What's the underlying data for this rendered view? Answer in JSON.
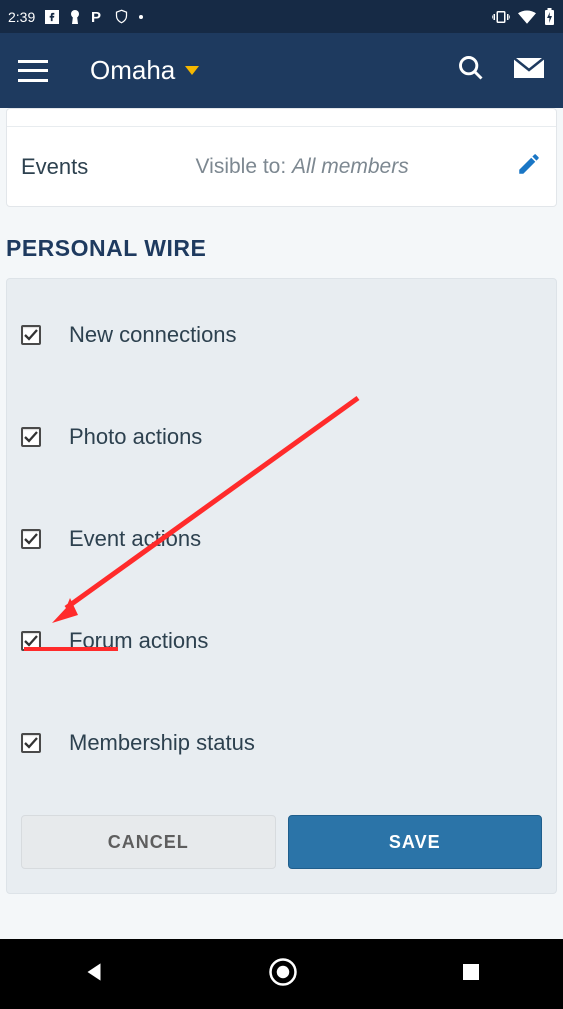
{
  "statusbar": {
    "time": "2:39"
  },
  "appbar": {
    "title": "Omaha"
  },
  "events_card": {
    "label": "Events",
    "visibility_prefix": "Visible to: ",
    "visibility_value": "All members"
  },
  "section_title": "PERSONAL WIRE",
  "checks": [
    {
      "label": "New connections",
      "checked": true
    },
    {
      "label": "Photo actions",
      "checked": true
    },
    {
      "label": "Event actions",
      "checked": true
    },
    {
      "label": "Forum actions",
      "checked": true
    },
    {
      "label": "Membership status",
      "checked": true
    }
  ],
  "buttons": {
    "cancel": "CANCEL",
    "save": "SAVE"
  }
}
